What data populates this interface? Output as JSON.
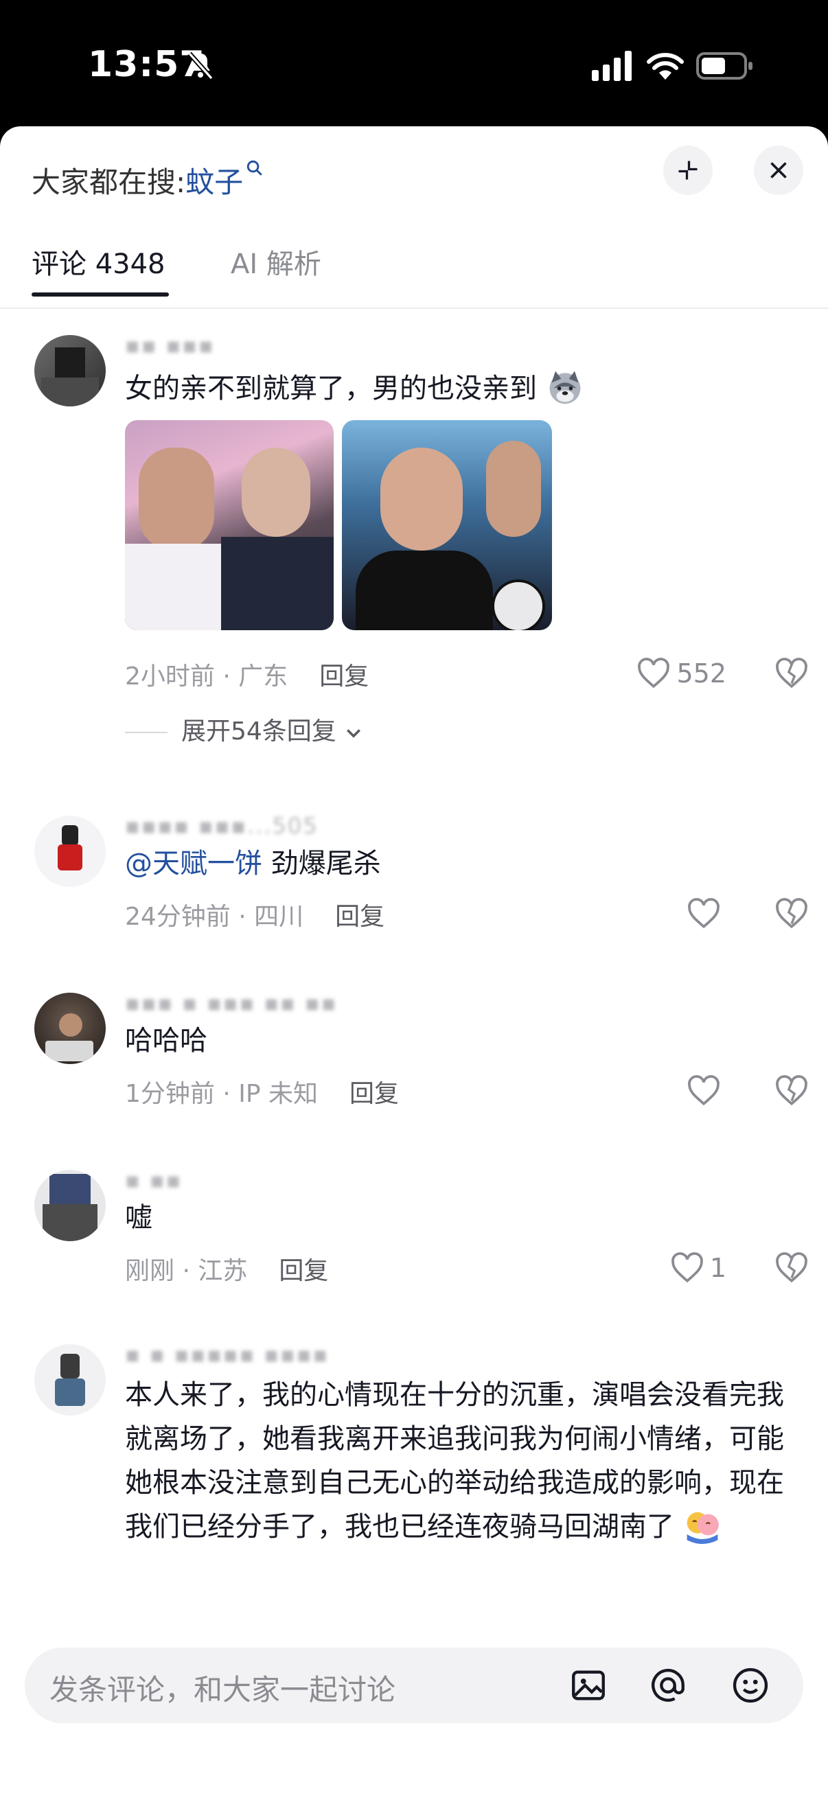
{
  "status_bar": {
    "time": "13:57"
  },
  "header": {
    "search_prefix": "大家都在搜:",
    "search_keyword": "蚊子"
  },
  "tabs": [
    {
      "label": "评论 4348"
    },
    {
      "label": "AI 解析"
    }
  ],
  "comments": [
    {
      "username": "▪▪ ▪▪▪",
      "text": "女的亲不到就算了，男的也没亲到",
      "meta": "2小时前 · 广东",
      "reply": "回复",
      "likes": "552",
      "expand": "展开54条回复"
    },
    {
      "username": "▪▪▪▪ ▪▪▪...505",
      "mention": "@天赋一饼",
      "text": " 劲爆尾杀",
      "meta": "24分钟前 · 四川",
      "reply": "回复",
      "likes": ""
    },
    {
      "username": "▪▪▪ ▪ ▪▪▪ ▪▪ ▪▪",
      "text": "哈哈哈",
      "meta": "1分钟前 · IP 未知",
      "reply": "回复",
      "likes": ""
    },
    {
      "username": "▪ ▪▪",
      "text": "嘘",
      "meta": "刚刚 · 江苏",
      "reply": "回复",
      "likes": "1"
    },
    {
      "username": "▪ ▪ ▪▪▪▪▪ ▪▪▪▪",
      "text": "本人来了，我的心情现在十分的沉重，演唱会没看完我就离场了，她看我离开来追我问我为何闹小情绪，可能她根本没注意到自己无心的举动给我造成的影响，现在我们已经分手了，我也已经连夜骑马回湖南了",
      "meta": "",
      "reply": "",
      "likes": ""
    }
  ],
  "input": {
    "placeholder": "发条评论，和大家一起讨论"
  },
  "icons": {
    "status": [
      "bell-off-icon",
      "signal-icon",
      "wifi-icon",
      "battery-icon"
    ],
    "header": [
      "search-icon",
      "collapse-icon",
      "close-icon"
    ],
    "comment": [
      "heart-icon",
      "dislike-icon",
      "chevron-down-icon"
    ],
    "input": [
      "image-icon",
      "at-icon",
      "emoji-icon"
    ]
  },
  "colors": {
    "link": "#24509e",
    "text": "#161823",
    "muted": "#9a9ba1"
  }
}
